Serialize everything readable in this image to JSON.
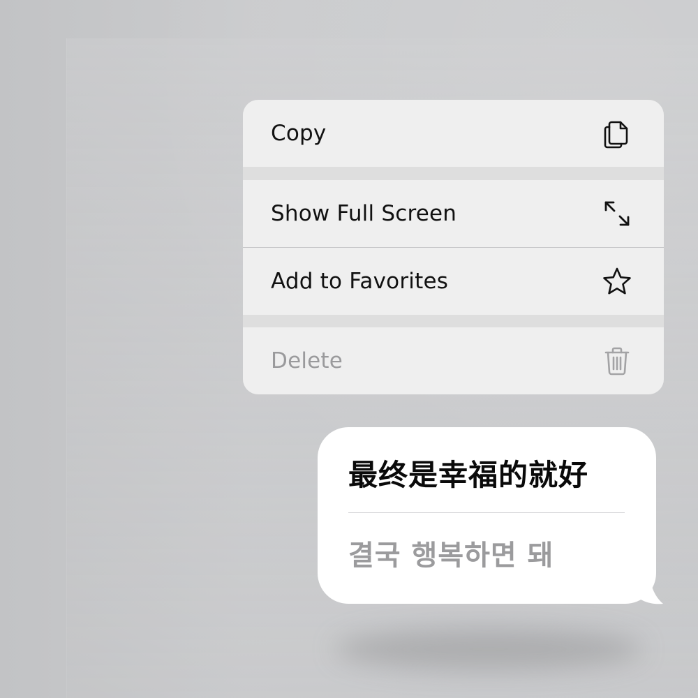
{
  "context_menu": {
    "items": [
      {
        "label": "Copy",
        "icon": "copy-icon",
        "enabled": true
      },
      {
        "label": "Show Full Screen",
        "icon": "expand-icon",
        "enabled": true
      },
      {
        "label": "Add to Favorites",
        "icon": "star-icon",
        "enabled": true
      },
      {
        "label": "Delete",
        "icon": "trash-icon",
        "enabled": false
      }
    ]
  },
  "message": {
    "primary_text": "最终是幸福的就好",
    "secondary_text": "결국 행복하면 돼"
  },
  "colors": {
    "background": "#c8c8ca",
    "menu_item": "#efefef",
    "menu_gap": "#dedede",
    "label": "#111111",
    "disabled_label": "#9a9a9c",
    "bubble": "#ffffff",
    "secondary_text": "#9b9b9d"
  }
}
